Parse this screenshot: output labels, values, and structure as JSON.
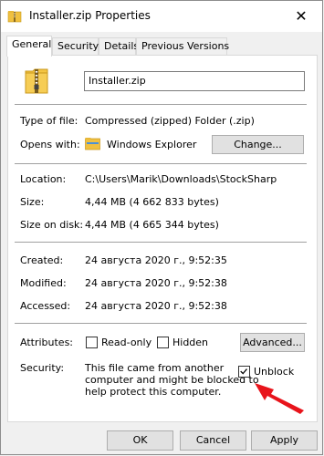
{
  "window": {
    "title": "Installer.zip Properties",
    "close_glyph": "✕"
  },
  "tabs": [
    {
      "label": "General",
      "active": true
    },
    {
      "label": "Security",
      "active": false
    },
    {
      "label": "Details",
      "active": false
    },
    {
      "label": "Previous Versions",
      "active": false
    }
  ],
  "general": {
    "file_name": "Installer.zip",
    "type_label": "Type of file:",
    "type_value": "Compressed (zipped) Folder (.zip)",
    "opens_label": "Opens with:",
    "opens_value": "Windows Explorer",
    "change_button": "Change...",
    "location_label": "Location:",
    "location_value": "C:\\Users\\Marik\\Downloads\\StockSharp",
    "size_label": "Size:",
    "size_value": "4,44 MB (4 662 833 bytes)",
    "size_on_disk_label": "Size on disk:",
    "size_on_disk_value": "4,44 MB (4 665 344 bytes)",
    "created_label": "Created:",
    "created_value": "24 августа 2020 г., 9:52:35",
    "modified_label": "Modified:",
    "modified_value": "24 августа 2020 г., 9:52:38",
    "accessed_label": "Accessed:",
    "accessed_value": "24 августа 2020 г., 9:52:38",
    "attributes_label": "Attributes:",
    "readonly_label": "Read-only",
    "hidden_label": "Hidden",
    "advanced_button": "Advanced...",
    "security_label": "Security:",
    "security_text_1": "This file came from another",
    "security_text_2": "computer and might be blocked to",
    "security_text_3": "help protect this computer.",
    "unblock_label": "Unblock",
    "unblock_checked": true,
    "readonly_checked": false,
    "hidden_checked": false
  },
  "buttons": {
    "ok": "OK",
    "cancel": "Cancel",
    "apply": "Apply"
  },
  "colors": {
    "arrow": "#e8141b",
    "folder": "#f0c040"
  }
}
